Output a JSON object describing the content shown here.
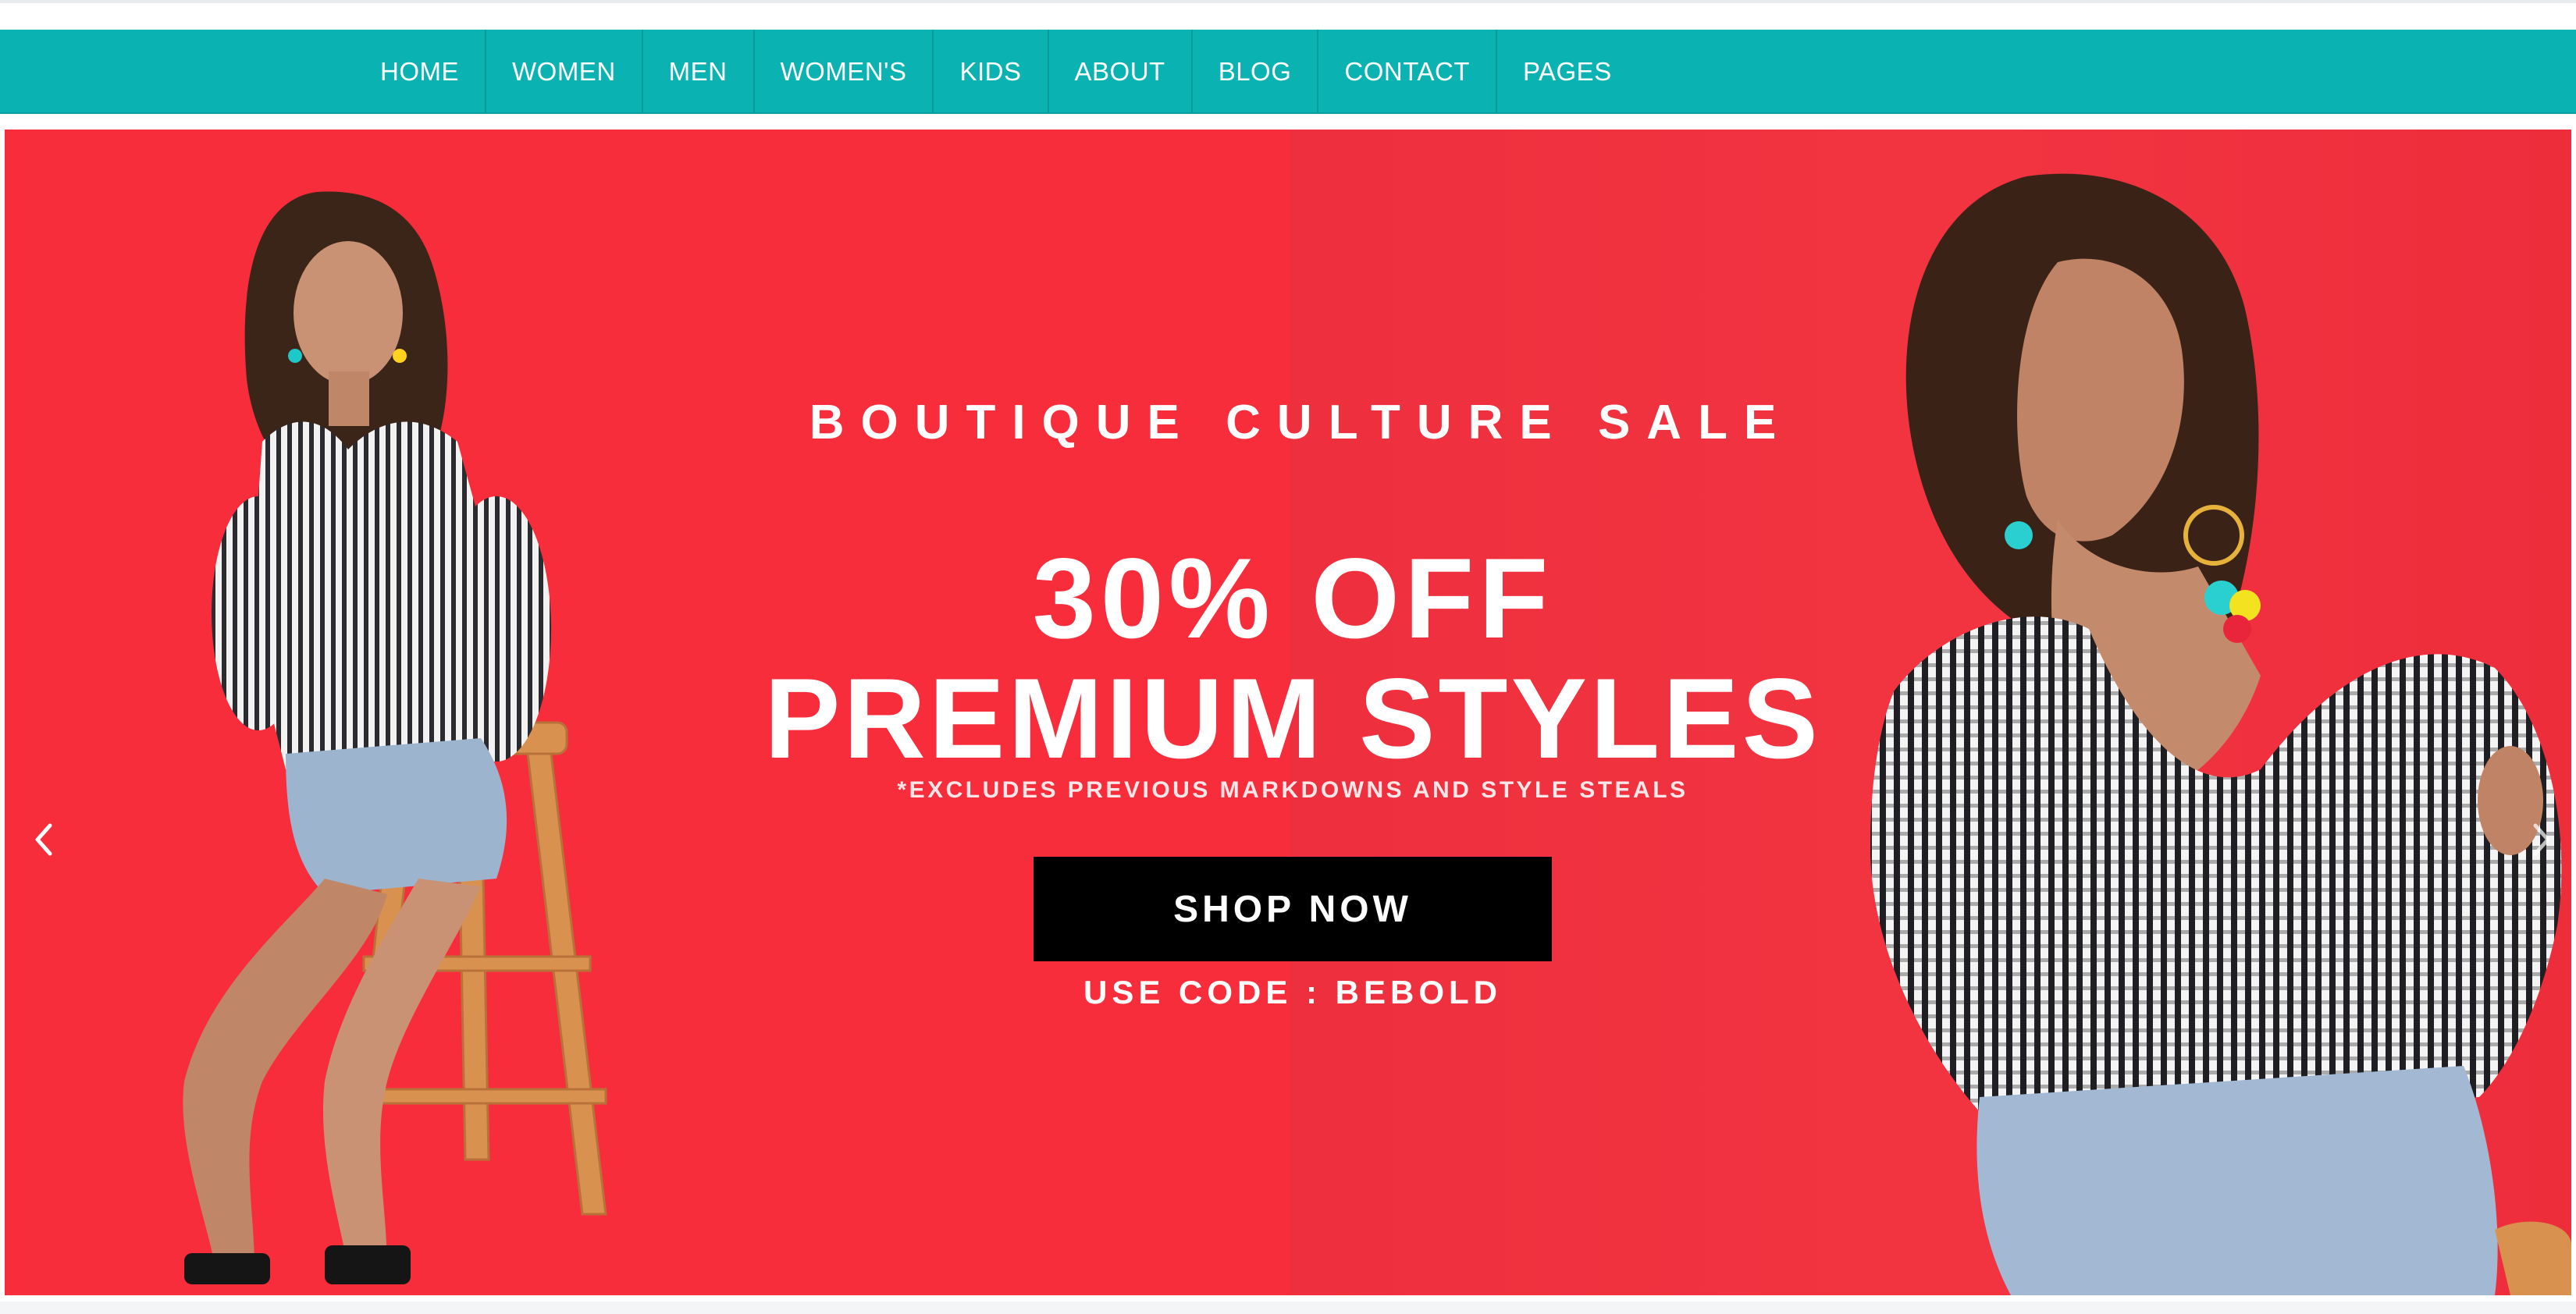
{
  "nav": {
    "items": [
      {
        "label": "HOME"
      },
      {
        "label": "WOMEN"
      },
      {
        "label": "MEN"
      },
      {
        "label": "WOMEN'S"
      },
      {
        "label": "KIDS"
      },
      {
        "label": "ABOUT"
      },
      {
        "label": "BLOG"
      },
      {
        "label": "CONTACT"
      },
      {
        "label": "PAGES"
      }
    ]
  },
  "hero": {
    "kicker": "BOUTIQUE CULTURE SALE",
    "headline_line1": "30% OFF",
    "headline_line2": "PREMIUM STYLES",
    "note": "*EXCLUDES PREVIOUS MARKDOWNS AND STYLE STEALS",
    "cta_label": "SHOP NOW",
    "code": "USE CODE : BEBOLD"
  },
  "colors": {
    "nav_bg": "#0bb2b2",
    "hero_bg": "#f72d3b",
    "cta_bg": "#000000",
    "text": "#ffffff"
  },
  "icons": {
    "prev": "chevron-left-icon",
    "next": "chevron-right-icon"
  }
}
